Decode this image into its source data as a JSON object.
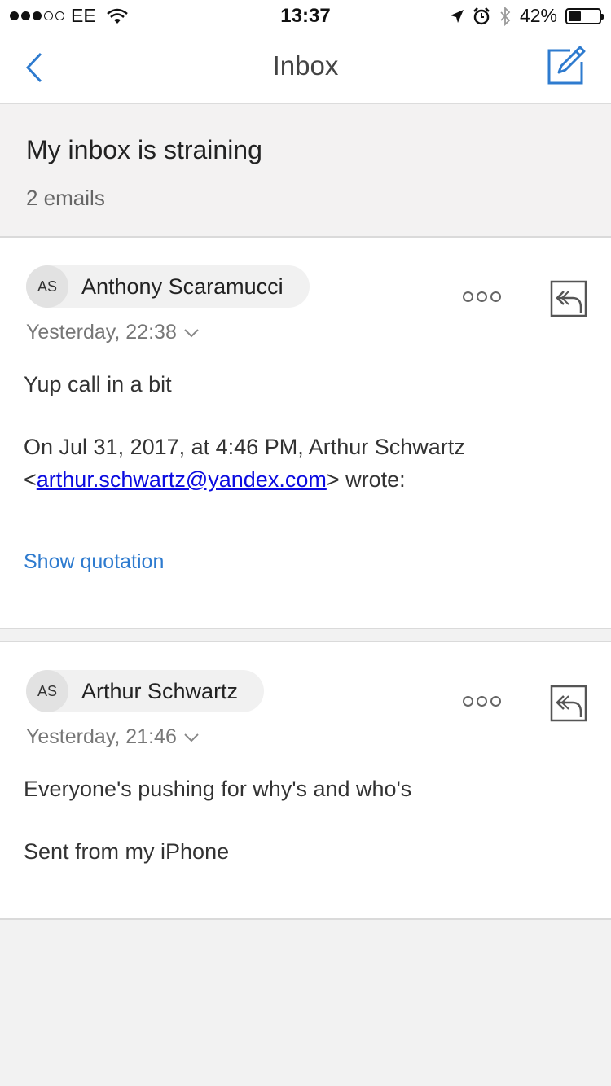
{
  "status_bar": {
    "carrier": "EE",
    "time": "13:37",
    "battery": "42%",
    "battery_level": 0.42
  },
  "nav": {
    "title": "Inbox",
    "back_icon": "chevron-left-icon",
    "compose_icon": "compose-icon"
  },
  "thread": {
    "subject": "My inbox is straining",
    "count": "2 emails"
  },
  "messages": [
    {
      "initials": "AS",
      "sender": "Anthony Scaramucci",
      "time": "Yesterday, 22:38",
      "body": "Yup call in a bit",
      "quote_line1": "On Jul 31, 2017, at 4:46 PM, Arthur Schwartz",
      "quote_lt": "<",
      "quote_email": "arthur.schwartz@yandex.com",
      "quote_tail": "> wrote:",
      "show_quotation": "Show quotation"
    },
    {
      "initials": "AS",
      "sender": "Arthur Schwartz",
      "time": "Yesterday, 21:46",
      "body": "Everyone's pushing for why's and who's",
      "signature": "Sent from my iPhone"
    }
  ],
  "colors": {
    "accent": "#2e7bcf",
    "link": "#0b0be0",
    "background": "#f2f2f2"
  }
}
